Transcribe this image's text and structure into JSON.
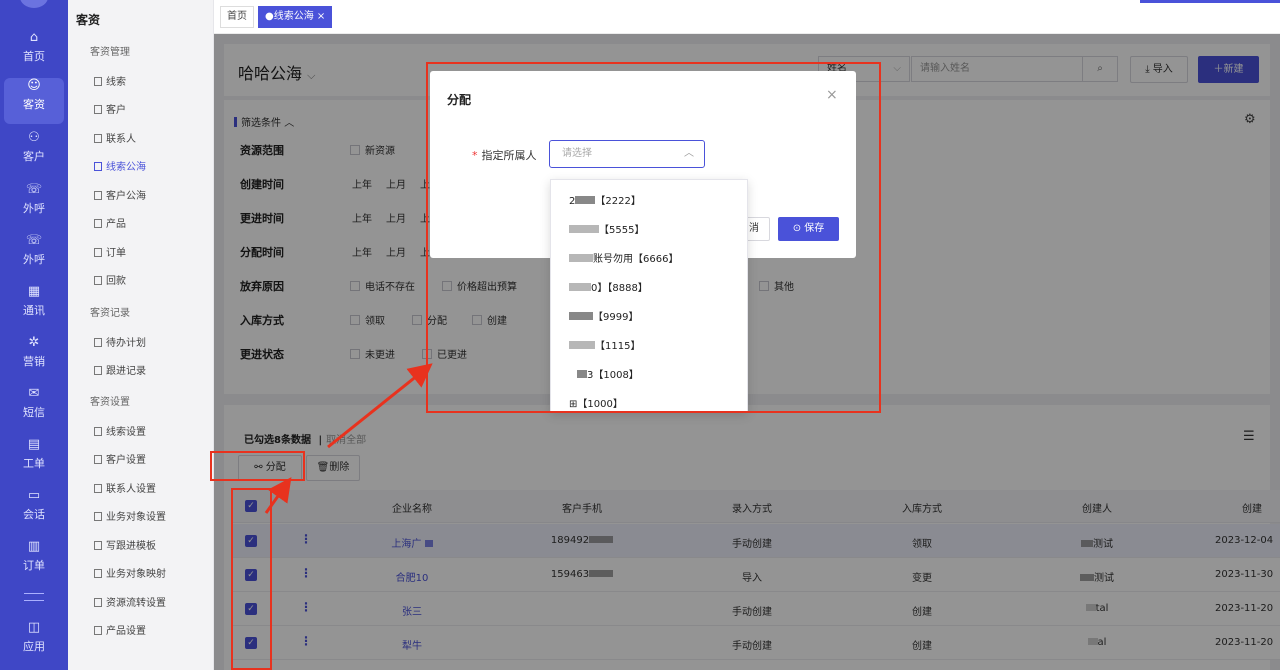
{
  "nav": {
    "items": [
      {
        "label": "首页",
        "icon": "⌂"
      },
      {
        "label": "客资",
        "icon": "☺"
      },
      {
        "label": "客户",
        "icon": "⚇"
      },
      {
        "label": "外呼",
        "icon": "☏"
      },
      {
        "label": "外呼",
        "icon": "☏"
      },
      {
        "label": "通讯",
        "icon": "▦"
      },
      {
        "label": "营销",
        "icon": "✲"
      },
      {
        "label": "短信",
        "icon": "✉"
      },
      {
        "label": "工单",
        "icon": "▤"
      },
      {
        "label": "会话",
        "icon": "▭"
      },
      {
        "label": "订单",
        "icon": "▥"
      },
      {
        "label": "应用",
        "icon": "◫"
      }
    ]
  },
  "sidebar": {
    "title": "客资",
    "groups": [
      {
        "label": "客资管理",
        "items": [
          "线索",
          "客户",
          "联系人",
          "线索公海",
          "客户公海",
          "产品",
          "订单",
          "回款"
        ]
      },
      {
        "label": "客资记录",
        "items": [
          "待办计划",
          "跟进记录"
        ]
      },
      {
        "label": "客资设置",
        "items": [
          "线索设置",
          "客户设置",
          "联系人设置",
          "业务对象设置",
          "写跟进模板",
          "业务对象映射",
          "资源流转设置",
          "产品设置"
        ]
      }
    ]
  },
  "tabs": [
    {
      "label": "首页"
    },
    {
      "label": "●线索公海 ×"
    }
  ],
  "header": {
    "title": "哈哈公海",
    "title_caret": "⌵",
    "field_select": "姓名",
    "search_placeholder": "请输入姓名",
    "search_icon": "⌕",
    "import_label": "导入",
    "new_label": "新建"
  },
  "filters": {
    "toggle_label": "筛选条件",
    "rows": [
      {
        "label": "资源范围",
        "options": [
          "新资源"
        ]
      },
      {
        "label": "创建时间",
        "options": [
          "上年",
          "上月",
          "上"
        ]
      },
      {
        "label": "更进时间",
        "options": [
          "上年",
          "上月",
          "上"
        ]
      },
      {
        "label": "分配时间",
        "options": [
          "上年",
          "上月",
          "上"
        ]
      },
      {
        "label": "放弃原因",
        "options": [
          "电话不存在",
          "价格超出预算",
          "其他"
        ]
      },
      {
        "label": "入库方式",
        "options": [
          "领取",
          "分配",
          "创建"
        ]
      },
      {
        "label": "更进状态",
        "options": [
          "未更进",
          "已更进"
        ]
      }
    ]
  },
  "list": {
    "selected_text": "已勾选8条数据",
    "cancel_all": "取消全部",
    "assign_label": "分配",
    "delete_label": "删除",
    "columns": [
      "企业名称",
      "客户手机",
      "录入方式",
      "入库方式",
      "创建人",
      "创建"
    ],
    "rows": [
      {
        "name": "上海广",
        "phone": "189492",
        "entry": "手动创建",
        "stock": "领取",
        "creator": "测试",
        "created": "2023-12-04"
      },
      {
        "name": "合肥10",
        "phone": "159463",
        "entry": "导入",
        "stock": "变更",
        "creator": "测试",
        "created": "2023-11-30"
      },
      {
        "name": "张三",
        "phone": "",
        "entry": "手动创建",
        "stock": "创建",
        "creator": "tal",
        "created": "2023-11-20"
      },
      {
        "name": "犁牛",
        "phone": "",
        "entry": "手动创建",
        "stock": "创建",
        "creator": "al",
        "created": "2023-11-20"
      }
    ]
  },
  "dialog": {
    "title": "分配",
    "close": "×",
    "field_label": "指定所属人",
    "required_mark": "*",
    "select_placeholder": "请选择",
    "cancel_label": "消",
    "save_label": "保存",
    "options": [
      "【2222】",
      "【5555】",
      "账号勿用【6666】",
      "0】【8888】",
      "【9999】",
      "【1115】",
      "3【1008】",
      "【1000】"
    ]
  },
  "colors": {
    "nav_bg": "#3f47c6",
    "accent": "#4a52d9",
    "annotation_red": "#e8321e"
  }
}
